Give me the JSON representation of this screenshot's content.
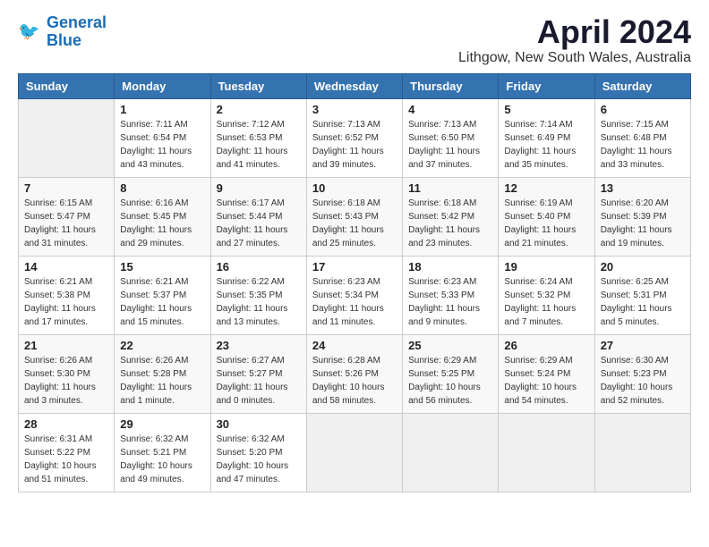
{
  "header": {
    "logo_line1": "General",
    "logo_line2": "Blue",
    "month_year": "April 2024",
    "location": "Lithgow, New South Wales, Australia"
  },
  "weekdays": [
    "Sunday",
    "Monday",
    "Tuesday",
    "Wednesday",
    "Thursday",
    "Friday",
    "Saturday"
  ],
  "weeks": [
    [
      {
        "day": "",
        "info": ""
      },
      {
        "day": "1",
        "info": "Sunrise: 7:11 AM\nSunset: 6:54 PM\nDaylight: 11 hours\nand 43 minutes."
      },
      {
        "day": "2",
        "info": "Sunrise: 7:12 AM\nSunset: 6:53 PM\nDaylight: 11 hours\nand 41 minutes."
      },
      {
        "day": "3",
        "info": "Sunrise: 7:13 AM\nSunset: 6:52 PM\nDaylight: 11 hours\nand 39 minutes."
      },
      {
        "day": "4",
        "info": "Sunrise: 7:13 AM\nSunset: 6:50 PM\nDaylight: 11 hours\nand 37 minutes."
      },
      {
        "day": "5",
        "info": "Sunrise: 7:14 AM\nSunset: 6:49 PM\nDaylight: 11 hours\nand 35 minutes."
      },
      {
        "day": "6",
        "info": "Sunrise: 7:15 AM\nSunset: 6:48 PM\nDaylight: 11 hours\nand 33 minutes."
      }
    ],
    [
      {
        "day": "7",
        "info": "Sunrise: 6:15 AM\nSunset: 5:47 PM\nDaylight: 11 hours\nand 31 minutes."
      },
      {
        "day": "8",
        "info": "Sunrise: 6:16 AM\nSunset: 5:45 PM\nDaylight: 11 hours\nand 29 minutes."
      },
      {
        "day": "9",
        "info": "Sunrise: 6:17 AM\nSunset: 5:44 PM\nDaylight: 11 hours\nand 27 minutes."
      },
      {
        "day": "10",
        "info": "Sunrise: 6:18 AM\nSunset: 5:43 PM\nDaylight: 11 hours\nand 25 minutes."
      },
      {
        "day": "11",
        "info": "Sunrise: 6:18 AM\nSunset: 5:42 PM\nDaylight: 11 hours\nand 23 minutes."
      },
      {
        "day": "12",
        "info": "Sunrise: 6:19 AM\nSunset: 5:40 PM\nDaylight: 11 hours\nand 21 minutes."
      },
      {
        "day": "13",
        "info": "Sunrise: 6:20 AM\nSunset: 5:39 PM\nDaylight: 11 hours\nand 19 minutes."
      }
    ],
    [
      {
        "day": "14",
        "info": "Sunrise: 6:21 AM\nSunset: 5:38 PM\nDaylight: 11 hours\nand 17 minutes."
      },
      {
        "day": "15",
        "info": "Sunrise: 6:21 AM\nSunset: 5:37 PM\nDaylight: 11 hours\nand 15 minutes."
      },
      {
        "day": "16",
        "info": "Sunrise: 6:22 AM\nSunset: 5:35 PM\nDaylight: 11 hours\nand 13 minutes."
      },
      {
        "day": "17",
        "info": "Sunrise: 6:23 AM\nSunset: 5:34 PM\nDaylight: 11 hours\nand 11 minutes."
      },
      {
        "day": "18",
        "info": "Sunrise: 6:23 AM\nSunset: 5:33 PM\nDaylight: 11 hours\nand 9 minutes."
      },
      {
        "day": "19",
        "info": "Sunrise: 6:24 AM\nSunset: 5:32 PM\nDaylight: 11 hours\nand 7 minutes."
      },
      {
        "day": "20",
        "info": "Sunrise: 6:25 AM\nSunset: 5:31 PM\nDaylight: 11 hours\nand 5 minutes."
      }
    ],
    [
      {
        "day": "21",
        "info": "Sunrise: 6:26 AM\nSunset: 5:30 PM\nDaylight: 11 hours\nand 3 minutes."
      },
      {
        "day": "22",
        "info": "Sunrise: 6:26 AM\nSunset: 5:28 PM\nDaylight: 11 hours\nand 1 minute."
      },
      {
        "day": "23",
        "info": "Sunrise: 6:27 AM\nSunset: 5:27 PM\nDaylight: 11 hours\nand 0 minutes."
      },
      {
        "day": "24",
        "info": "Sunrise: 6:28 AM\nSunset: 5:26 PM\nDaylight: 10 hours\nand 58 minutes."
      },
      {
        "day": "25",
        "info": "Sunrise: 6:29 AM\nSunset: 5:25 PM\nDaylight: 10 hours\nand 56 minutes."
      },
      {
        "day": "26",
        "info": "Sunrise: 6:29 AM\nSunset: 5:24 PM\nDaylight: 10 hours\nand 54 minutes."
      },
      {
        "day": "27",
        "info": "Sunrise: 6:30 AM\nSunset: 5:23 PM\nDaylight: 10 hours\nand 52 minutes."
      }
    ],
    [
      {
        "day": "28",
        "info": "Sunrise: 6:31 AM\nSunset: 5:22 PM\nDaylight: 10 hours\nand 51 minutes."
      },
      {
        "day": "29",
        "info": "Sunrise: 6:32 AM\nSunset: 5:21 PM\nDaylight: 10 hours\nand 49 minutes."
      },
      {
        "day": "30",
        "info": "Sunrise: 6:32 AM\nSunset: 5:20 PM\nDaylight: 10 hours\nand 47 minutes."
      },
      {
        "day": "",
        "info": ""
      },
      {
        "day": "",
        "info": ""
      },
      {
        "day": "",
        "info": ""
      },
      {
        "day": "",
        "info": ""
      }
    ]
  ]
}
